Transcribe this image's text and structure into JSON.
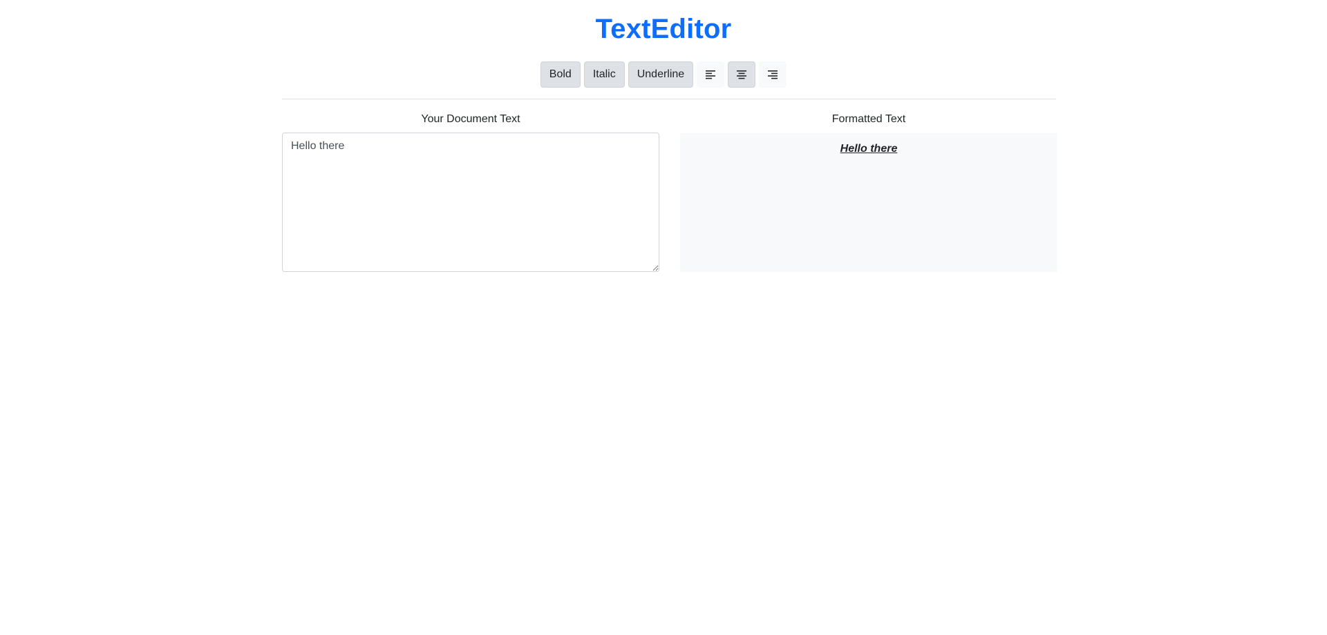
{
  "app": {
    "title": "TextEditor"
  },
  "toolbar": {
    "bold_label": "Bold",
    "italic_label": "Italic",
    "underline_label": "Underline",
    "align_buttons": [
      {
        "name": "align-left",
        "icon": "align-left-icon",
        "active": false
      },
      {
        "name": "align-center",
        "icon": "align-center-icon",
        "active": true
      },
      {
        "name": "align-right",
        "icon": "align-right-icon",
        "active": false
      }
    ]
  },
  "editor": {
    "label": "Your Document Text",
    "value": "Hello there"
  },
  "preview": {
    "label": "Formatted Text",
    "text": "Hello there",
    "formatting": {
      "bold": true,
      "italic": true,
      "underline": true,
      "alignment": "center"
    }
  },
  "colors": {
    "accent": "#0d6efd",
    "preview_background": "#f8f9fa",
    "button_background": "#dee2e6"
  }
}
